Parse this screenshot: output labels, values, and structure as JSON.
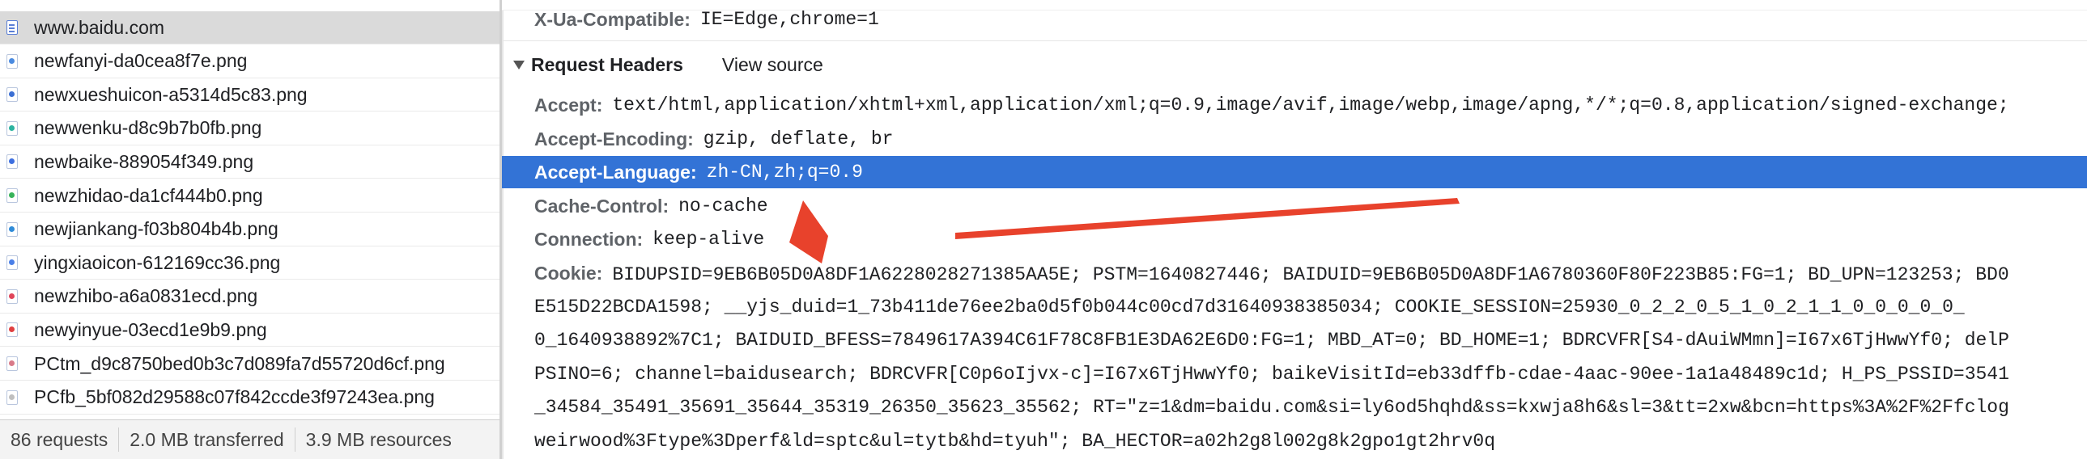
{
  "requests": [
    {
      "name": "www.baidu.com",
      "type": "document",
      "color": "#5b7fd6",
      "selected": true
    },
    {
      "name": "newfanyi-da0cea8f7e.png",
      "type": "image",
      "color": "#4a8ae0"
    },
    {
      "name": "newxueshuicon-a5314d5c83.png",
      "type": "image",
      "color": "#3b6fd4"
    },
    {
      "name": "newwenku-d8c9b7b0fb.png",
      "type": "image",
      "color": "#2bb3a0"
    },
    {
      "name": "newbaike-889054f349.png",
      "type": "image",
      "color": "#3d6fe0"
    },
    {
      "name": "newzhidao-da1cf444b0.png",
      "type": "image",
      "color": "#37b35a"
    },
    {
      "name": "newjiankang-f03b804b4b.png",
      "type": "image",
      "color": "#2f8bd8"
    },
    {
      "name": "yingxiaoicon-612169cc36.png",
      "type": "image",
      "color": "#4a7fe8"
    },
    {
      "name": "newzhibo-a6a0831ecd.png",
      "type": "image",
      "color": "#e0455a"
    },
    {
      "name": "newyinyue-03ecd1e9b9.png",
      "type": "image",
      "color": "#e04040"
    },
    {
      "name": "PCtm_d9c8750bed0b3c7d089fa7d55720d6cf.png",
      "type": "image",
      "color": "#d97b8a"
    },
    {
      "name": "PCfb_5bf082d29588c07f842ccde3f97243ea.png",
      "type": "image",
      "color": "#bfbfbf"
    }
  ],
  "status": {
    "requests": "86 requests",
    "transferred": "2.0 MB transferred",
    "resources": "3.9 MB resources"
  },
  "top_header": {
    "name": "X-Ua-Compatible:",
    "value": "IE=Edge,chrome=1"
  },
  "section": {
    "title": "Request Headers",
    "view_source": "View source"
  },
  "headers": [
    {
      "name": "Accept:",
      "value": "text/html,application/xhtml+xml,application/xml;q=0.9,image/avif,image/webp,image/apng,*/*;q=0.8,application/signed-exchange;"
    },
    {
      "name": "Accept-Encoding:",
      "value": "gzip, deflate, br"
    },
    {
      "name": "Accept-Language:",
      "value": "zh-CN,zh;q=0.9",
      "highlighted": true
    },
    {
      "name": "Cache-Control:",
      "value": "no-cache"
    },
    {
      "name": "Connection:",
      "value": "keep-alive"
    }
  ],
  "cookie": {
    "name": "Cookie:",
    "lines": [
      "BIDUPSID=9EB6B05D0A8DF1A6228028271385AA5E; PSTM=1640827446; BAIDUID=9EB6B05D0A8DF1A6780360F80F223B85:FG=1; BD_UPN=123253; BD0",
      "E515D22BCDA1598; __yjs_duid=1_73b411de76ee2ba0d5f0b044c00cd7d31640938385034; COOKIE_SESSION=25930_0_2_2_0_5_1_0_2_1_1_0_0_0_0_0_",
      "0_1640938892%7C1; BAIDUID_BFESS=7849617A394C61F78C8FB1E3DA62E6D0:FG=1; MBD_AT=0; BD_HOME=1; BDRCVFR[S4-dAuiWMmn]=I67x6TjHwwYf0; delP",
      "PSINO=6; channel=baidusearch; BDRCVFR[C0p6oIjvx-c]=I67x6TjHwwYf0; baikeVisitId=eb33dffb-cdae-4aac-90ee-1a1a48489c1d; H_PS_PSSID=3541",
      "_34584_35491_35691_35644_35319_26350_35623_35562; RT=\"z=1&dm=baidu.com&si=ly6od5hqhd&ss=kxwja8h6&sl=3&tt=2xw&bcn=https%3A%2F%2Ffclog",
      "weirwood%3Ftype%3Dperf&ld=sptc&ul=tytb&hd=tyuh\"; BA_HECTOR=a02h2g8l002g8k2gpo1gt2hrv0q"
    ]
  },
  "annotation": {
    "arrow_color": "#e8422c",
    "points_to": "Connection: keep-alive"
  },
  "colors": {
    "selection": "#3373d6",
    "header_name": "#5f6368",
    "row_selected": "#dadada"
  }
}
